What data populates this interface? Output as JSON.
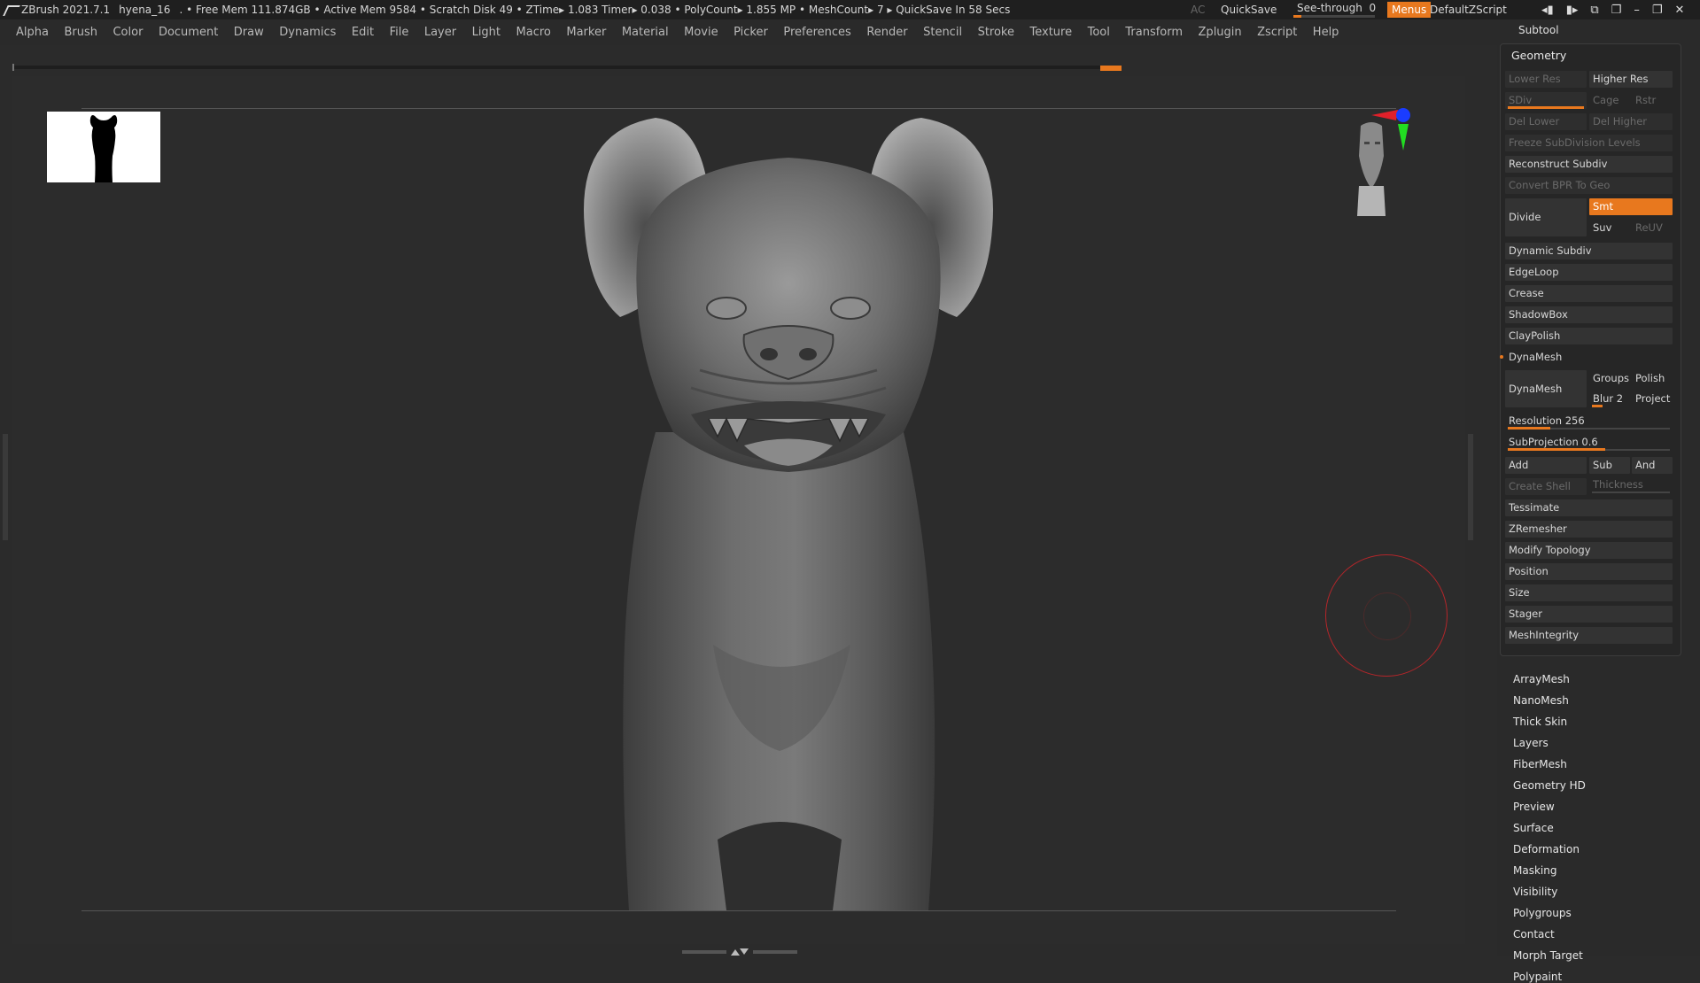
{
  "titlebar": {
    "app": "ZBrush 2021.7.1",
    "doc": "hyena_16",
    "stats": ". • Free Mem 111.874GB • Active Mem 9584 • Scratch Disk 49 •  ZTime▸ 1.083 Timer▸ 0.038 • PolyCount▸ 1.855 MP  • MeshCount▸ 7  ▸ QuickSave In 58 Secs",
    "ac": "AC",
    "quicksave": "QuickSave",
    "seethrough_label": "See-through",
    "seethrough_value": "0",
    "seethrough_fraction": 0.1,
    "menus": "Menus",
    "default_script": "DefaultZScript"
  },
  "menubar": {
    "items": [
      "Alpha",
      "Brush",
      "Color",
      "Document",
      "Draw",
      "Dynamics",
      "Edit",
      "File",
      "Layer",
      "Light",
      "Macro",
      "Marker",
      "Material",
      "Movie",
      "Picker",
      "Preferences",
      "Render",
      "Stencil",
      "Stroke",
      "Texture",
      "Tool",
      "Transform",
      "Zplugin",
      "Zscript",
      "Help"
    ]
  },
  "panel": {
    "subtool": "Subtool",
    "geometry": {
      "title": "Geometry",
      "lower_res": "Lower Res",
      "higher_res": "Higher Res",
      "sdiv": "SDiv",
      "cage": "Cage",
      "rstr": "Rstr",
      "del_lower": "Del Lower",
      "del_higher": "Del Higher",
      "freeze": "Freeze SubDivision Levels",
      "reconstruct": "Reconstruct Subdiv",
      "convert_bpr": "Convert BPR To Geo",
      "divide": "Divide",
      "smt": "Smt",
      "suv": "Suv",
      "reuv": "ReUV",
      "dynamic_subdiv": "Dynamic Subdiv",
      "edgeloop": "EdgeLoop",
      "crease": "Crease",
      "shadowbox": "ShadowBox",
      "claypolish": "ClayPolish",
      "dynamesh_section": "DynaMesh",
      "dynamesh_btn": "DynaMesh",
      "groups": "Groups",
      "polish": "Polish",
      "blur": "Blur 2",
      "project": "Project",
      "resolution": "Resolution 256",
      "subprojection": "SubProjection 0.6",
      "add": "Add",
      "sub": "Sub",
      "and": "And",
      "create_shell": "Create Shell",
      "thickness": "Thickness",
      "tessimate": "Tessimate",
      "zremesher": "ZRemesher",
      "modify_topology": "Modify Topology",
      "position": "Position",
      "size": "Size",
      "stager": "Stager",
      "meshintegrity": "MeshIntegrity"
    },
    "sections": [
      "ArrayMesh",
      "NanoMesh",
      "Thick Skin",
      "Layers",
      "FiberMesh",
      "Geometry HD",
      "Preview",
      "Surface",
      "Deformation",
      "Masking",
      "Visibility",
      "Polygroups",
      "Contact",
      "Morph Target",
      "Polypaint"
    ]
  },
  "colors": {
    "accent": "#e8781e",
    "brush_circle": "#b3262a"
  },
  "icons": {
    "app_logo": "zbrush-logo-icon",
    "gizmo": "orientation-gizmo-icon",
    "head": "navigation-head-icon"
  }
}
